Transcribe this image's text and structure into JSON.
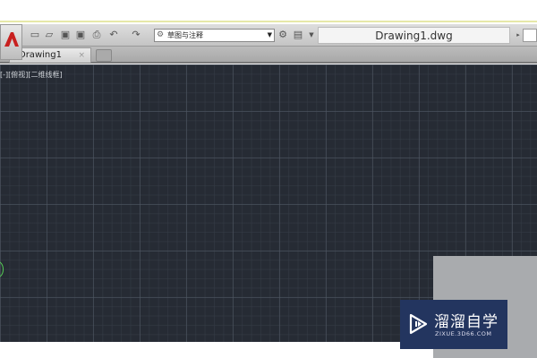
{
  "toolbar": {
    "workspace": "草图与注释",
    "title": "Drawing1.dwg",
    "icons": [
      "new-icon",
      "open-icon",
      "save-icon",
      "save-as-icon",
      "print-icon",
      "undo-icon",
      "redo-icon"
    ]
  },
  "tabs": [
    {
      "label": "Drawing1",
      "close": "×"
    }
  ],
  "viewport": {
    "label": "[-][俯视][二维线框]"
  },
  "watermark": {
    "name": "溜溜自学",
    "url": "ZIXUE.3D66.COM"
  },
  "colors": {
    "canvas": "#262b34",
    "watermark": "#23355f",
    "autocad_red": "#c8201f"
  }
}
